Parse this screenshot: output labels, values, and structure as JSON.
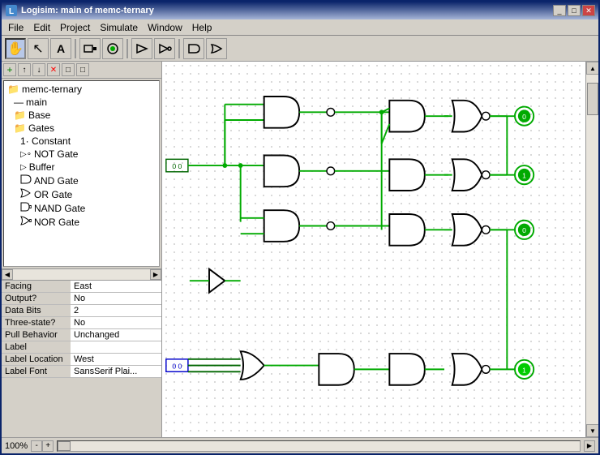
{
  "titlebar": {
    "title": "Logisim: main of memc-ternary",
    "icon": "L",
    "buttons": [
      "_",
      "□",
      "✕"
    ]
  },
  "menubar": {
    "items": [
      "File",
      "Edit",
      "Project",
      "Simulate",
      "Window",
      "Help"
    ]
  },
  "toolbar": {
    "tools": [
      {
        "name": "hand-tool",
        "icon": "✋",
        "active": true
      },
      {
        "name": "select-tool",
        "icon": "↖",
        "active": false
      },
      {
        "name": "text-tool",
        "icon": "A",
        "active": false
      },
      {
        "name": "pin-output-tool",
        "icon": "▪",
        "active": false
      },
      {
        "name": "pin-input-tool",
        "icon": "●",
        "active": false
      },
      {
        "name": "buffer-tool",
        "icon": "▷",
        "active": false
      },
      {
        "name": "not-tool",
        "icon": "▷",
        "active": false
      },
      {
        "name": "and-tool",
        "icon": "D",
        "active": false
      }
    ]
  },
  "tree": {
    "toolbar_buttons": [
      "+",
      "↑",
      "↓",
      "✕",
      "□",
      "□"
    ],
    "items": [
      {
        "label": "memc-ternary",
        "indent": 0,
        "icon": "📁"
      },
      {
        "label": "main",
        "indent": 1,
        "icon": "📄"
      },
      {
        "label": "Base",
        "indent": 1,
        "icon": "📁"
      },
      {
        "label": "Gates",
        "indent": 1,
        "icon": "📁"
      },
      {
        "label": "1· Constant",
        "indent": 2,
        "icon": ""
      },
      {
        "label": "NOT Gate",
        "indent": 2,
        "icon": "▷"
      },
      {
        "label": "Buffer",
        "indent": 2,
        "icon": "▷"
      },
      {
        "label": "AND Gate",
        "indent": 2,
        "icon": "D"
      },
      {
        "label": "OR Gate",
        "indent": 2,
        "icon": "⊃"
      },
      {
        "label": "NAND Gate",
        "indent": 2,
        "icon": "D"
      },
      {
        "label": "NOR Gate",
        "indent": 2,
        "icon": "⊃"
      }
    ]
  },
  "properties": {
    "rows": [
      {
        "label": "Facing",
        "value": "East"
      },
      {
        "label": "Output?",
        "value": "No"
      },
      {
        "label": "Data Bits",
        "value": "2"
      },
      {
        "label": "Three-state?",
        "value": "No"
      },
      {
        "label": "Pull Behavior",
        "value": "Unchanged"
      },
      {
        "label": "Label",
        "value": ""
      },
      {
        "label": "Label Location",
        "value": "West"
      },
      {
        "label": "Label Font",
        "value": "SansSerif Plai..."
      }
    ]
  },
  "statusbar": {
    "zoom": "100%",
    "zoom_minus": "-",
    "zoom_plus": "+"
  },
  "colors": {
    "wire_green": "#00aa00",
    "wire_dark_green": "#006600",
    "wire_blue": "#0000aa",
    "gate_outline": "#000000",
    "accent": "#0a246a"
  }
}
